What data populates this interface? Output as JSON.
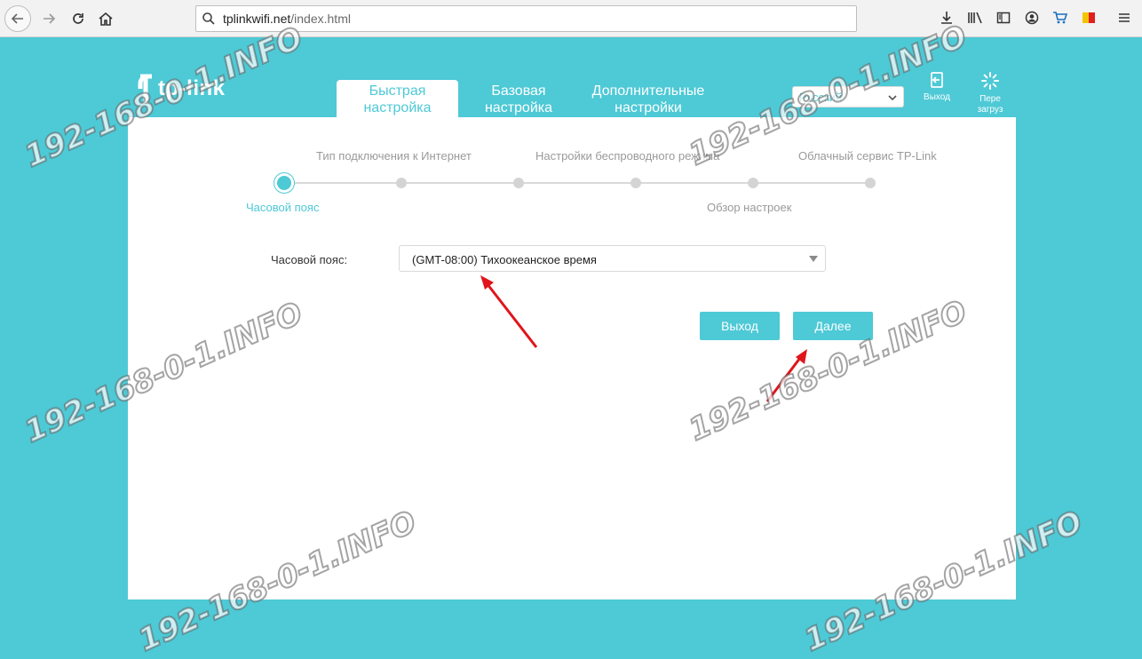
{
  "browser": {
    "url_host": "tplinkwifi.net",
    "url_path": "/index.html"
  },
  "header": {
    "logo_text": "tp-link",
    "tabs": [
      {
        "label": "Быстрая настройка",
        "line1": "Быстрая",
        "line2": "настройка",
        "active": true
      },
      {
        "label": "Базовая настройка",
        "line1": "Базовая",
        "line2": "настройка",
        "active": false
      },
      {
        "label": "Дополнительные настройки",
        "line1": "Дополнительные",
        "line2": "настройки",
        "active": false
      }
    ],
    "language": "Русский",
    "logout_label": "Выход",
    "reboot_line1": "Пере",
    "reboot_line2": "загруз"
  },
  "wizard": {
    "steps_top": [
      "Тип подключения к Интернет",
      "Настройки беспроводного режима",
      "Облачный сервис TP-Link"
    ],
    "steps_bottom": [
      "Часовой пояс",
      "Обзор настроек"
    ],
    "active_step": "Часовой пояс"
  },
  "form": {
    "timezone_label": "Часовой пояс:",
    "timezone_value": "(GMT-08:00) Тихоокеанское время"
  },
  "buttons": {
    "exit": "Выход",
    "next": "Далее"
  },
  "watermark": "192-168-0-1.INFO",
  "colors": {
    "accent": "#4ec9d6",
    "arrow": "#e0151b"
  }
}
